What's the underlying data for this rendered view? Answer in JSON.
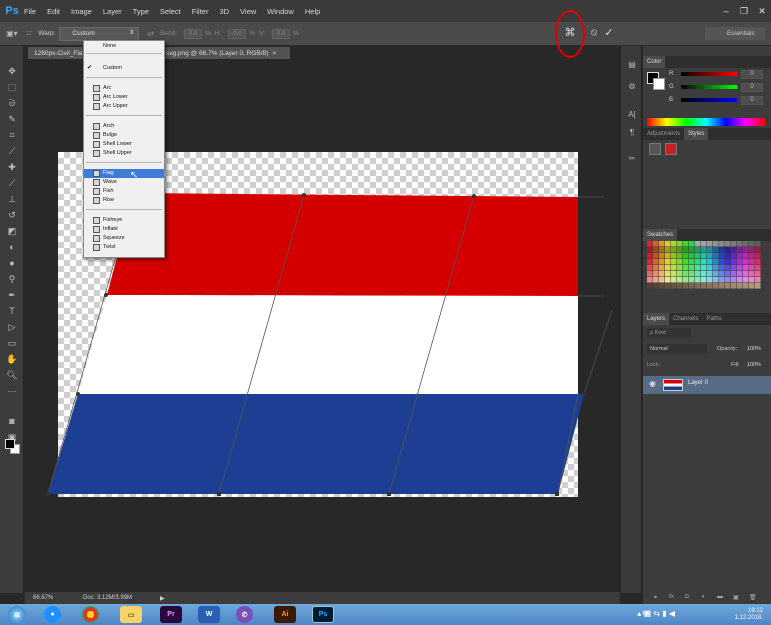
{
  "app": {
    "logo": "Ps"
  },
  "menu": [
    "File",
    "Edit",
    "Image",
    "Layer",
    "Type",
    "Select",
    "Filter",
    "3D",
    "View",
    "Window",
    "Help"
  ],
  "options": {
    "warp_label": "Warp:",
    "warp_value": "Custom",
    "bend_label": "Bend:",
    "bend_value": "0.0",
    "h_label": "H:",
    "h_value": "0.0",
    "v_label": "V:",
    "v_value": "0.0",
    "pct": "%",
    "workspace": "Essentials"
  },
  "document": {
    "tab_part1": "1280px-Civil_Fla",
    "tab_part2": "svg.png @ 66.7% (Layer 0, RGB/8)",
    "tab_close": "×"
  },
  "warp_dropdown": {
    "items": [
      "None",
      "Custom",
      "Arc",
      "Arc Lower",
      "Arc Upper",
      "Arch",
      "Bulge",
      "Shell Lower",
      "Shell Upper",
      "Flag",
      "Wave",
      "Fish",
      "Rise",
      "Fisheye",
      "Inflate",
      "Squeeze",
      "Twist"
    ],
    "checked": "Custom",
    "highlighted": "Flag"
  },
  "panels": {
    "color_tab": "Color",
    "color_channels": [
      "R",
      "G",
      "B"
    ],
    "color_channel_values": [
      "0",
      "0",
      "0"
    ],
    "adjustments_tab": "Adjustments",
    "styles_tab": "Styles",
    "swatches_tab": "Swatches",
    "layers_tab": "Layers",
    "channels_tab": "Channels",
    "paths_tab": "Paths",
    "kind_label": "ρ Kind",
    "blend_mode": "Normal",
    "opacity_label": "Opacity:",
    "opacity_value": "100%",
    "lock_label": "Lock:",
    "fill_label": "Fill:",
    "fill_value": "100%",
    "layer_name": "Layer 0"
  },
  "status": {
    "zoom": "66.67%",
    "doc_size": "Doc: 3.12M/3.99M"
  },
  "taskbar": {
    "lang": "HR",
    "time": "19:12",
    "date": "1.12.2018."
  },
  "colors": {
    "flag_red": "#d40000",
    "flag_white": "#ffffff",
    "flag_blue": "#1c3e93",
    "highlight": "#3d7bd6",
    "annotation_red": "#e00000"
  },
  "icons": [
    "photoshop-logo",
    "warp-toggle-icon",
    "cancel-icon",
    "commit-icon"
  ]
}
